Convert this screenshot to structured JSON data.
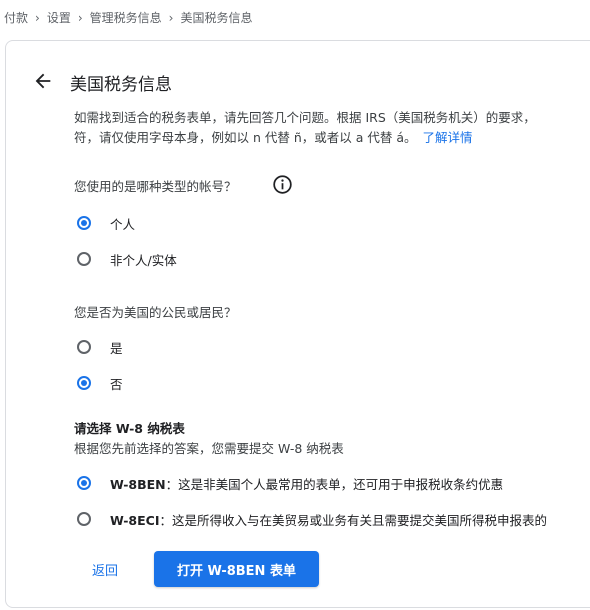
{
  "breadcrumb": {
    "items": [
      "付款",
      "设置",
      "管理税务信息",
      "美国税务信息"
    ],
    "separator": "›"
  },
  "header": {
    "title": "美国税务信息"
  },
  "intro": {
    "line1": "如需找到适合的税务表单，请先回答几个问题。根据 IRS（美国税务机关）的要求，",
    "line2": "符，请仅使用字母本身，例如以 n 代替 ñ，或者以 a 代替 á。",
    "learn_more": "了解详情"
  },
  "account_type": {
    "question": "您使用的是哪种类型的帐号？",
    "options": [
      {
        "label": "个人",
        "checked": true
      },
      {
        "label": "非个人/实体",
        "checked": false
      }
    ]
  },
  "us_person": {
    "question": "您是否为美国的公民或居民？",
    "options": [
      {
        "label": "是",
        "checked": false
      },
      {
        "label": "否",
        "checked": true
      }
    ]
  },
  "w8": {
    "title": "请选择 W-8 纳税表",
    "subtitle": "根据您先前选择的答案，您需要提交 W-8 纳税表",
    "options": [
      {
        "code": "W-8BEN",
        "desc": "：这是非美国个人最常用的表单，还可用于申报税收条约优惠",
        "checked": true
      },
      {
        "code": "W-8ECI",
        "desc": "：这是所得收入与在美贸易或业务有关且需要提交美国所得税申报表的",
        "checked": false
      }
    ]
  },
  "actions": {
    "back": "返回",
    "open_form": "打开 W-8BEN 表单"
  },
  "colors": {
    "accent": "#1a73e8",
    "text": "#202124",
    "muted": "#5f6368",
    "border": "#dadce0"
  }
}
